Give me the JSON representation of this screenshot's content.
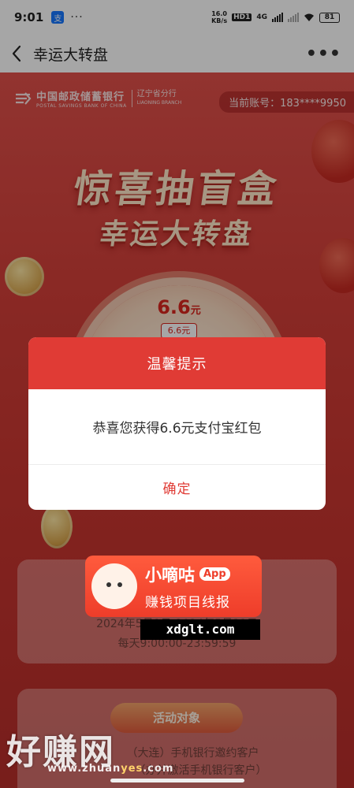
{
  "status_bar": {
    "time": "9:01",
    "alipay_icon_text": "支",
    "more_dots": "···",
    "speed_value": "16.0",
    "speed_unit": "KB/s",
    "hd_label": "HD1",
    "network": "4G",
    "battery": "81"
  },
  "nav": {
    "title": "幸运大转盘",
    "more": "•••"
  },
  "banner": {
    "bank_name_cn": "中国邮政储蓄银行",
    "bank_name_en": "POSTAL SAVINGS BANK OF CHINA",
    "branch_cn": "辽宁省分行",
    "branch_en": "LIAONING BRANCH",
    "account_label": "当前账号：183****9950",
    "headline_1": "惊喜抽盲盒",
    "headline_2": "幸运大转盘"
  },
  "wheel": {
    "prize_amount": "6.6",
    "prize_unit": "元",
    "prize_tag": "6.6元"
  },
  "info_cards": {
    "time_range": "2024年5月1日-2024年5月31日",
    "daily_hours": "每天9:00:00-23:59:59",
    "target_button": "活动对象",
    "target_line_1": "（大连）手机银行邀约客户",
    "target_line_2": "（办并激活手机银行客户）"
  },
  "dialog": {
    "title": "温馨提示",
    "message": "恭喜您获得6.6元支付宝红包",
    "confirm": "确定"
  },
  "watermark": {
    "app_name": "小嘀咕",
    "app_badge": "App",
    "slogan": "赚钱项目线报",
    "site": "xdglt.com",
    "brand": "好赚网",
    "brand_url_a": "www.zhuan",
    "brand_url_b": "yes",
    "brand_url_c": ".com"
  },
  "colors": {
    "accent_red": "#e03b35",
    "page_bg": "#c8352f"
  }
}
